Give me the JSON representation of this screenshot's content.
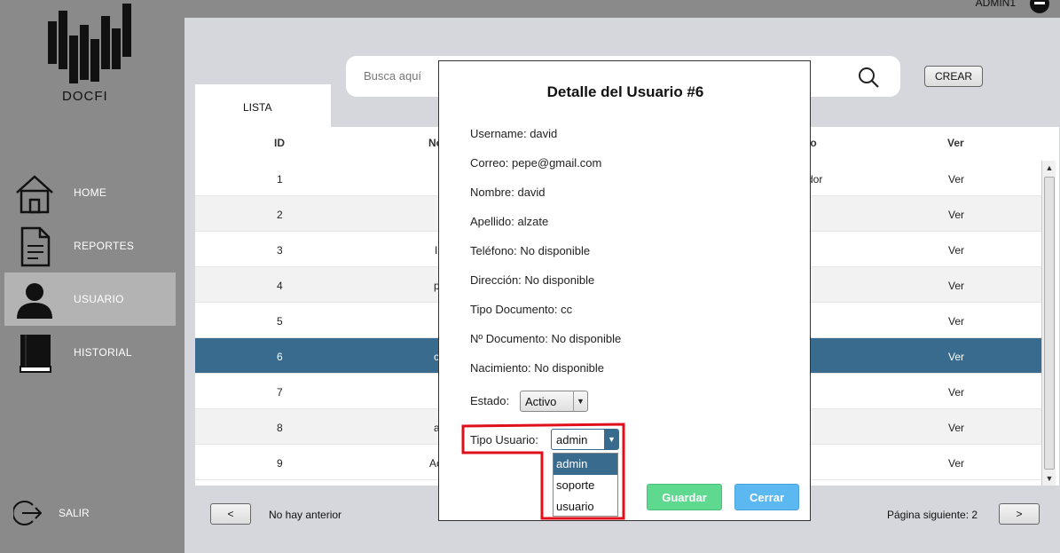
{
  "header": {
    "user_label": "ADMIN1",
    "user_icon": "minus-circle-icon"
  },
  "brand": {
    "name": "DOCFI"
  },
  "sidebar": {
    "items": [
      {
        "label": "HOME",
        "icon": "home-icon",
        "active": false
      },
      {
        "label": "REPORTES",
        "icon": "document-icon",
        "active": false
      },
      {
        "label": "USUARIO",
        "icon": "user-icon",
        "active": true
      },
      {
        "label": "HISTORIAL",
        "icon": "book-icon",
        "active": false
      }
    ],
    "logout_label": "SALIR"
  },
  "search": {
    "placeholder": "Busca aquí"
  },
  "toolbar": {
    "create_label": "CREAR"
  },
  "tabs": {
    "list_label": "LISTA"
  },
  "table": {
    "headers": [
      "ID",
      "No",
      "io",
      "Ver"
    ],
    "rows": [
      {
        "id": "1",
        "name": "",
        "role": "dor",
        "action": "Ver"
      },
      {
        "id": "2",
        "name": "",
        "role": "",
        "action": "Ver"
      },
      {
        "id": "3",
        "name": "I",
        "role": "",
        "action": "Ver"
      },
      {
        "id": "4",
        "name": "p",
        "role": "",
        "action": "Ver"
      },
      {
        "id": "5",
        "name": "",
        "role": "",
        "action": "Ver"
      },
      {
        "id": "6",
        "name": "c",
        "role": "",
        "action": "Ver"
      },
      {
        "id": "7",
        "name": "",
        "role": "",
        "action": "Ver"
      },
      {
        "id": "8",
        "name": "a",
        "role": "",
        "action": "Ver"
      },
      {
        "id": "9",
        "name": "Ac",
        "role": "",
        "action": "Ver"
      }
    ],
    "selected_row": "6"
  },
  "pagination": {
    "prev_label": "<",
    "prev_text": "No hay anterior",
    "next_text": "Página siguiente: 2",
    "next_label": ">"
  },
  "modal": {
    "title": "Detalle del Usuario #6",
    "fields": [
      "Username: david",
      "Correo: pepe@gmail.com",
      "Nombre: david",
      "Apellido: alzate",
      "Teléfono: No disponible",
      "Dirección: No disponible",
      "Tipo Documento: cc",
      "Nº Documento: No disponible",
      "Nacimiento: No disponible"
    ],
    "estado_label": "Estado:",
    "estado_value": "Activo",
    "tipo_label": "Tipo Usuario:",
    "tipo_value": "admin",
    "tipo_options": [
      "admin",
      "soporte",
      "usuario"
    ],
    "save_label": "Guardar",
    "close_label": "Cerrar"
  },
  "colors": {
    "selected_row": "#386b8e",
    "save_button": "#5ed98f",
    "close_button": "#5bb8f0",
    "highlight": "#e0101a"
  }
}
